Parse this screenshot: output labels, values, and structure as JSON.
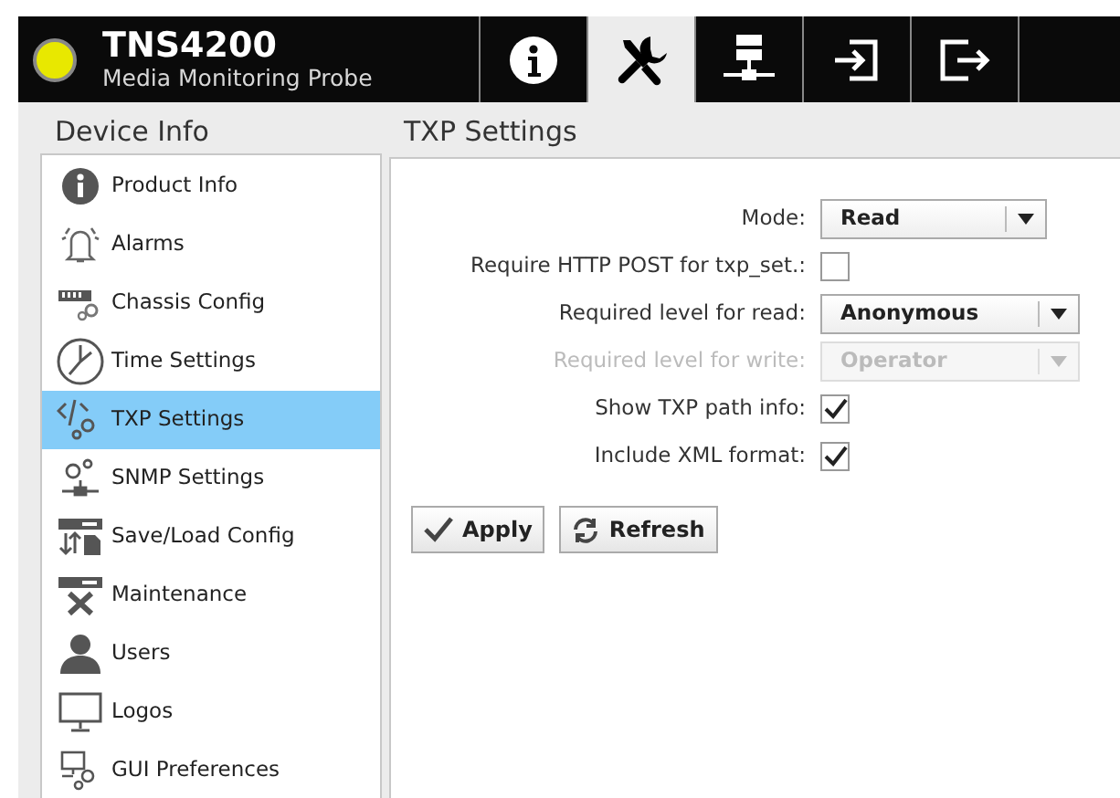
{
  "header": {
    "title": "TNS4200",
    "subtitle": "Media Monitoring Probe"
  },
  "tabs": [
    {
      "kind": "info",
      "selected": false
    },
    {
      "kind": "tools",
      "selected": true
    },
    {
      "kind": "network",
      "selected": false
    },
    {
      "kind": "login",
      "selected": false
    },
    {
      "kind": "logout",
      "selected": false
    }
  ],
  "sidebar": {
    "title": "Device Info",
    "items": [
      {
        "label": "Product Info",
        "kind": "info",
        "selected": false
      },
      {
        "label": "Alarms",
        "kind": "bell",
        "selected": false
      },
      {
        "label": "Chassis Config",
        "kind": "chassis",
        "selected": false
      },
      {
        "label": "Time Settings",
        "kind": "clock",
        "selected": false
      },
      {
        "label": "TXP Settings",
        "kind": "code",
        "selected": true
      },
      {
        "label": "SNMP Settings",
        "kind": "snmp",
        "selected": false
      },
      {
        "label": "Save/Load Config",
        "kind": "save",
        "selected": false
      },
      {
        "label": "Maintenance",
        "kind": "maint",
        "selected": false
      },
      {
        "label": "Users",
        "kind": "user",
        "selected": false
      },
      {
        "label": "Logos",
        "kind": "monitor",
        "selected": false
      },
      {
        "label": "GUI Preferences",
        "kind": "gui",
        "selected": false
      }
    ]
  },
  "panel": {
    "title": "TXP Settings",
    "fields": [
      {
        "kind": "select",
        "label": "Mode:",
        "value": "Read",
        "disabled": false
      },
      {
        "kind": "checkbox",
        "label": "Require HTTP POST for txp_set.:",
        "checked": false
      },
      {
        "kind": "select",
        "label": "Required level for read:",
        "value": "Anonymous",
        "disabled": false
      },
      {
        "kind": "select",
        "label": "Required level for write:",
        "value": "Operator",
        "disabled": true
      },
      {
        "kind": "checkbox",
        "label": "Show TXP path info:",
        "checked": true
      },
      {
        "kind": "checkbox",
        "label": "Include XML format:",
        "checked": true
      }
    ],
    "buttons": [
      {
        "label": "Apply",
        "kind": "apply"
      },
      {
        "label": "Refresh",
        "kind": "refresh"
      }
    ]
  }
}
